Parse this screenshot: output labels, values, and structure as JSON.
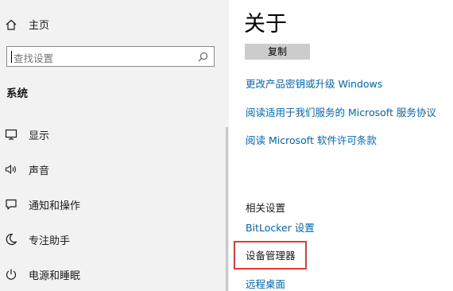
{
  "sidebar": {
    "home_label": "主页",
    "search": {
      "placeholder": "查找设置"
    },
    "section_title": "系统",
    "items": [
      {
        "label": "显示",
        "icon": "monitor-icon"
      },
      {
        "label": "声音",
        "icon": "speaker-icon"
      },
      {
        "label": "通知和操作",
        "icon": "message-icon"
      },
      {
        "label": "专注助手",
        "icon": "moon-icon"
      },
      {
        "label": "电源和睡眠",
        "icon": "power-icon"
      }
    ]
  },
  "main": {
    "title": "关于",
    "copy_button": "复制",
    "links": [
      "更改产品密钥或升级 Windows",
      "阅读适用于我们服务的 Microsoft 服务协议",
      "阅读 Microsoft 软件许可条款"
    ],
    "related": {
      "heading": "相关设置",
      "bitlocker": "BitLocker 设置",
      "device_manager": "设备管理器",
      "remote_desktop": "远程桌面"
    }
  },
  "colors": {
    "link": "#0067b8",
    "sidebar_bg": "#f2f2f2",
    "highlight": "#e53935",
    "button_bg": "#cccccc"
  }
}
